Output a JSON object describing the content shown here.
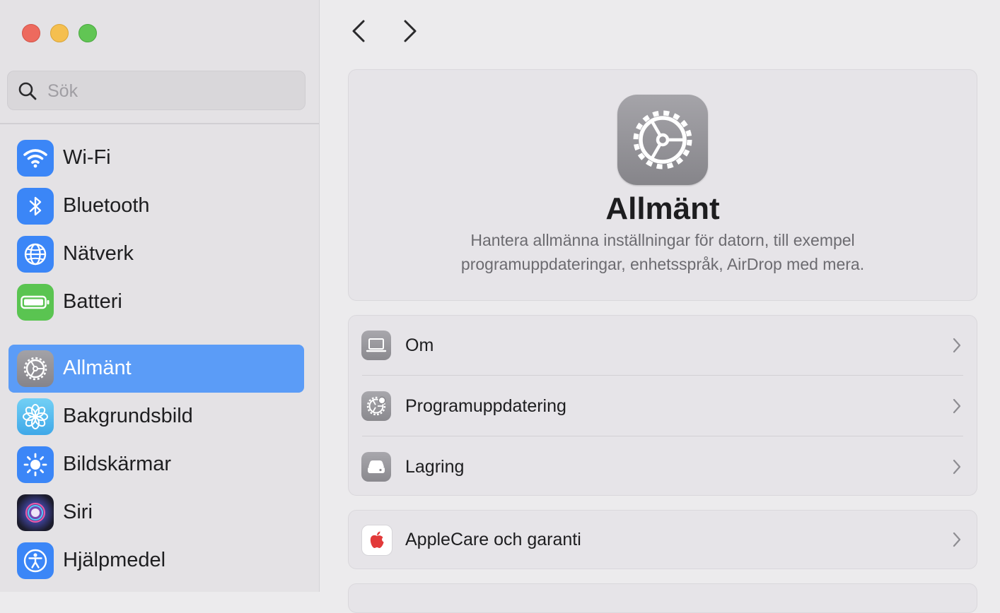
{
  "sidebar": {
    "search": {
      "placeholder": "Sök"
    },
    "items": [
      {
        "label": "Wi-Fi",
        "icon": "wifi-icon",
        "color": "#3b86f7"
      },
      {
        "label": "Bluetooth",
        "icon": "bluetooth-icon",
        "color": "#3b86f7"
      },
      {
        "label": "Nätverk",
        "icon": "globe-icon",
        "color": "#3b86f7"
      },
      {
        "label": "Batteri",
        "icon": "battery-icon",
        "color": "#5ac451"
      },
      {
        "label": "Allmänt",
        "icon": "gear-icon",
        "color": "#8e8d92",
        "selected": true
      },
      {
        "label": "Bakgrundsbild",
        "icon": "flower-icon",
        "color": "#5ec2f0"
      },
      {
        "label": "Bildskärmar",
        "icon": "sun-icon",
        "color": "#3b86f7"
      },
      {
        "label": "Siri",
        "icon": "siri-icon",
        "color": "#2b2b3a"
      },
      {
        "label": "Hjälpmedel",
        "icon": "accessibility-icon",
        "color": "#3b86f7"
      }
    ]
  },
  "main": {
    "hero": {
      "title": "Allmänt",
      "description_line1": "Hantera allmänna inställningar för datorn, till exempel",
      "description_line2": "programuppdateringar, enhetsspråk, AirDrop med mera."
    },
    "group1": [
      {
        "label": "Om",
        "icon": "laptop-icon"
      },
      {
        "label": "Programuppdatering",
        "icon": "software-update-icon"
      },
      {
        "label": "Lagring",
        "icon": "storage-drive-icon"
      }
    ],
    "group2": [
      {
        "label": "AppleCare och garanti",
        "icon": "apple-logo-icon"
      }
    ]
  },
  "colors": {
    "selection": "#5b9cf7",
    "sidebar_bg": "#e4e2e5",
    "content_bg": "#ecebed"
  }
}
